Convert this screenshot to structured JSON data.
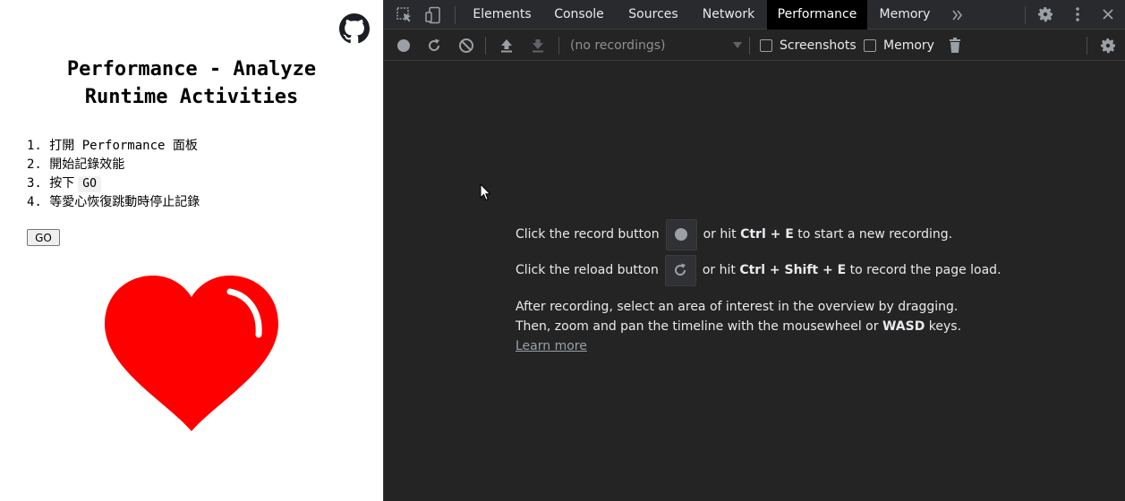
{
  "page": {
    "title_line1": "Performance - Analyze",
    "title_line2": "Runtime Activities",
    "steps": [
      {
        "num": "1.",
        "text": "打開 Performance 面板"
      },
      {
        "num": "2.",
        "text": "開始記錄效能"
      },
      {
        "num": "3.",
        "text": "按下",
        "kbd": "GO"
      },
      {
        "num": "4.",
        "text": "等愛心恢復跳動時停止記錄"
      }
    ],
    "go_button": "GO",
    "heart_color": "#ff0000"
  },
  "devtools": {
    "tabs": [
      "Elements",
      "Console",
      "Sources",
      "Network",
      "Performance",
      "Memory"
    ],
    "active_tab": "Performance",
    "recordings_placeholder": "(no recordings)",
    "screenshots_label": "Screenshots",
    "memory_label": "Memory",
    "landing": {
      "record_prefix": "Click the record button",
      "record_mid": "or hit",
      "record_keys": "Ctrl + E",
      "record_suffix": "to start a new recording.",
      "reload_prefix": "Click the reload button",
      "reload_mid": "or hit",
      "reload_keys": "Ctrl + Shift + E",
      "reload_suffix": "to record the page load.",
      "para_line1": "After recording, select an area of interest in the overview by dragging.",
      "para_line2_prefix": "Then, zoom and pan the timeline with the mousewheel or",
      "para_line2_keys": "WASD",
      "para_line2_suffix": "keys.",
      "learn_more": "Learn more"
    },
    "colors": {
      "panel_bg": "#242424",
      "toolbar_bg": "#292a2d",
      "active_tab_bg": "#000000",
      "text": "#e8eaed"
    }
  }
}
